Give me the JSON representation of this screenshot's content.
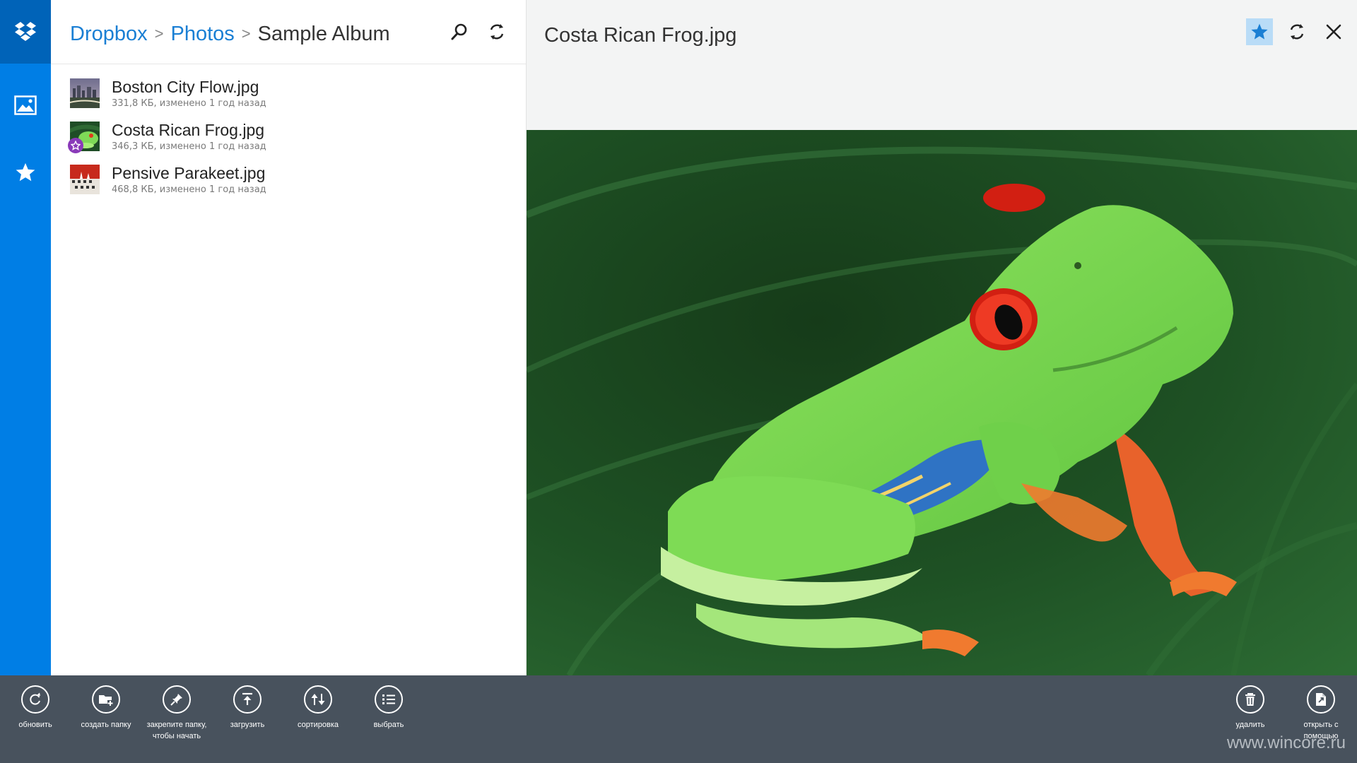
{
  "breadcrumb": {
    "root": "Dropbox",
    "folder": "Photos",
    "current": "Sample Album",
    "separator": ">"
  },
  "files": [
    {
      "name": "Boston City Flow.jpg",
      "meta": "331,8 КБ, изменено 1 год назад",
      "favorite": false
    },
    {
      "name": "Costa Rican Frog.jpg",
      "meta": "346,3 КБ, изменено 1 год назад",
      "favorite": true
    },
    {
      "name": "Pensive Parakeet.jpg",
      "meta": "468,8 КБ, изменено 1 год назад",
      "favorite": false
    }
  ],
  "preview": {
    "title": "Costa Rican Frog.jpg"
  },
  "appbar": {
    "left": [
      {
        "id": "refresh",
        "label": "обновить"
      },
      {
        "id": "new-folder",
        "label": "создать папку"
      },
      {
        "id": "pin",
        "label": "закрепите папку, чтобы начать"
      },
      {
        "id": "upload",
        "label": "загрузить"
      },
      {
        "id": "sort",
        "label": "сортировка"
      },
      {
        "id": "select",
        "label": "выбрать"
      }
    ],
    "right": [
      {
        "id": "delete",
        "label": "удалить"
      },
      {
        "id": "open-with",
        "label": "открыть с помощью"
      }
    ]
  },
  "watermark": "www.wincore.ru",
  "colors": {
    "accent": "#007ee5",
    "rail_active": "#0063b8",
    "link": "#1a7fd4",
    "appbar": "#48525d",
    "favorite_badge": "#8a3ab9",
    "preview_background": "#f3f4f4"
  },
  "icons": {
    "rail": [
      "dropbox-logo-icon",
      "photos-icon",
      "star-icon"
    ],
    "list_header": [
      "search-icon",
      "sync-icon"
    ],
    "preview_header": [
      "favorite-star-icon",
      "sync-icon",
      "close-icon"
    ]
  }
}
